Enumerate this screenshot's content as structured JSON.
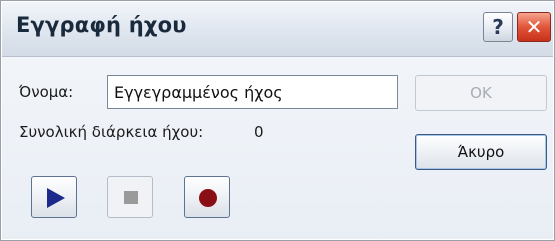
{
  "window": {
    "title": "Εγγραφή ήχου",
    "help_glyph": "?",
    "close_glyph": "✕"
  },
  "form": {
    "name_label": "Όνομα:",
    "name_value": "Εγγεγραμμένος ήχος",
    "duration_label": "Συνολική διάρκεια ήχου:",
    "duration_value": "0"
  },
  "buttons": {
    "ok_label": "OK",
    "ok_enabled": false,
    "cancel_label": "Άκυρο"
  },
  "media_controls": [
    {
      "icon": "play-icon",
      "enabled": true,
      "color": "#1c2a8c"
    },
    {
      "icon": "stop-icon",
      "enabled": false,
      "color": "#9a9a9a"
    },
    {
      "icon": "record-icon",
      "enabled": true,
      "color": "#8a0f14"
    }
  ]
}
